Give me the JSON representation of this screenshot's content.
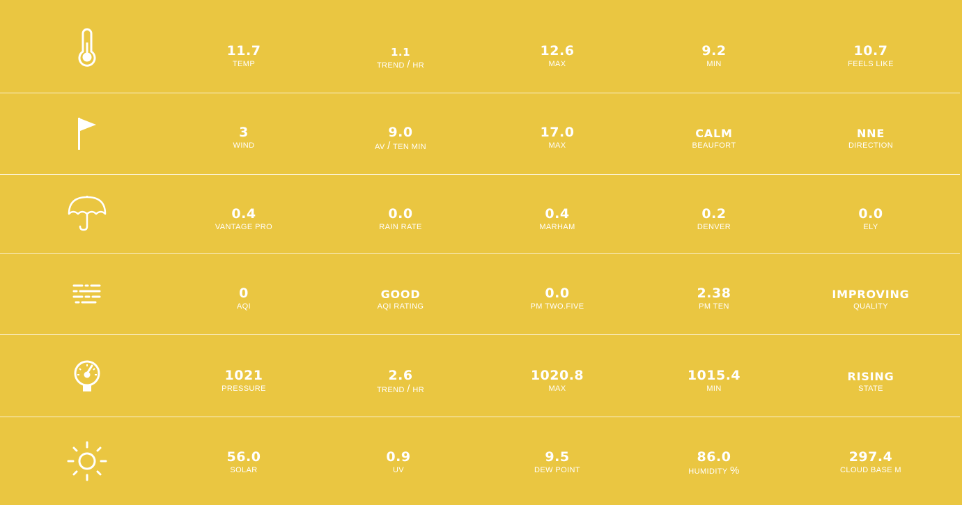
{
  "colors": {
    "background": "#EAC641",
    "text": "#FFFFFF",
    "divider": "#F5E7B0"
  },
  "rows": [
    {
      "icon": "thermometer-icon",
      "stats": [
        {
          "value": "11.7",
          "label": "TEMP"
        },
        {
          "value": "1.1",
          "label_parts": [
            "TREND",
            "/",
            "HR"
          ]
        },
        {
          "value": "12.6",
          "label": "MAX"
        },
        {
          "value": "9.2",
          "label": "MIN"
        },
        {
          "value": "10.7",
          "label": "FEELS LIKE"
        }
      ]
    },
    {
      "icon": "flag-icon",
      "stats": [
        {
          "value": "3",
          "label": "WIND"
        },
        {
          "value": "9.0",
          "label_parts": [
            "AV",
            "/",
            "TEN MIN"
          ]
        },
        {
          "value": "17.0",
          "label": "MAX"
        },
        {
          "value": "CALM",
          "label": "BEAUFORT"
        },
        {
          "value": "NNE",
          "label": "DIRECTION"
        }
      ]
    },
    {
      "icon": "umbrella-icon",
      "stats": [
        {
          "value": "0.4",
          "label": "VANTAGE PRO"
        },
        {
          "value": "0.0",
          "label": "RAIN RATE"
        },
        {
          "value": "0.4",
          "label": "MARHAM"
        },
        {
          "value": "0.2",
          "label": "DENVER"
        },
        {
          "value": "0.0",
          "label": "ELY"
        }
      ]
    },
    {
      "icon": "fog-icon",
      "stats": [
        {
          "value": "0",
          "label": "AQI"
        },
        {
          "value": "GOOD",
          "label": "AQI RATING"
        },
        {
          "value": "0.0",
          "label": "PM TWO.FIVE"
        },
        {
          "value": "2.38",
          "label": "PM TEN"
        },
        {
          "value": "IMPROVING",
          "label": "QUALITY"
        }
      ]
    },
    {
      "icon": "pressure-gauge-icon",
      "stats": [
        {
          "value": "1021",
          "label": "PRESSURE"
        },
        {
          "value": "2.6",
          "label_parts": [
            "TREND",
            "/",
            "HR"
          ]
        },
        {
          "value": "1020.8",
          "label": "MAX"
        },
        {
          "value": "1015.4",
          "label": "MIN"
        },
        {
          "value": "RISING",
          "label": "STATE"
        }
      ]
    },
    {
      "icon": "sun-icon",
      "stats": [
        {
          "value": "56.0",
          "label": "SOLAR"
        },
        {
          "value": "0.9",
          "label": "UV"
        },
        {
          "value": "9.5",
          "label": "DEW POINT"
        },
        {
          "value": "86.0",
          "label_parts": [
            "HUMIDITY",
            "%"
          ]
        },
        {
          "value": "297.4",
          "label": "CLOUD BASE M"
        }
      ]
    }
  ]
}
